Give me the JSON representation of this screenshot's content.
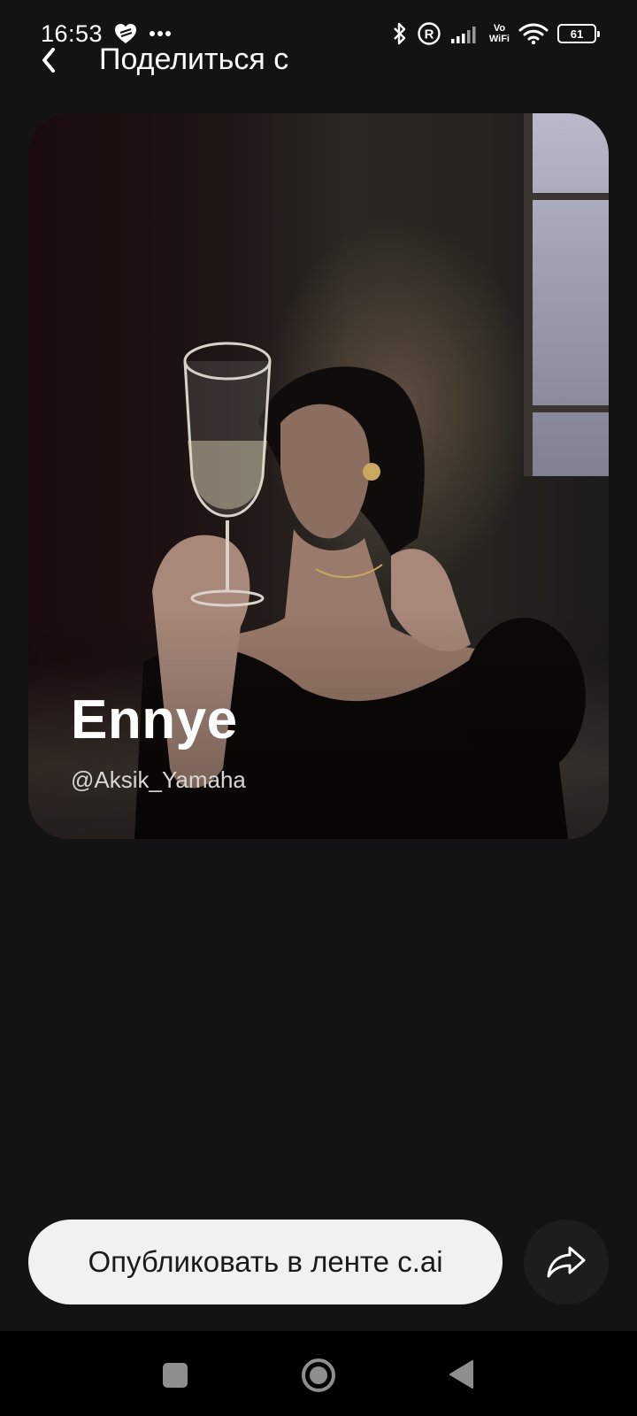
{
  "status_bar": {
    "time": "16:53",
    "battery": "61",
    "vowifi_top": "Vo",
    "vowifi_bottom": "WiFi",
    "icons": [
      "heart-icon",
      "more-icon",
      "bluetooth-icon",
      "registered-icon",
      "signal-icon",
      "vowifi-icon",
      "wifi-icon",
      "battery-icon"
    ]
  },
  "header": {
    "title": "Поделиться с",
    "back_icon": "chevron-left-icon"
  },
  "card": {
    "name": "Ennye",
    "handle": "@Aksik_Yamaha"
  },
  "actions": {
    "publish_label": "Опубликовать в ленте c.ai",
    "share_icon": "share-arrow-icon"
  },
  "navigation": {
    "icons": [
      "recents-square-icon",
      "home-circle-icon",
      "back-triangle-icon"
    ]
  },
  "colors": {
    "background": "#131313",
    "publish_button": "#f1f1f1",
    "share_button": "#1d1d1d",
    "nav_bar": "#000000"
  }
}
